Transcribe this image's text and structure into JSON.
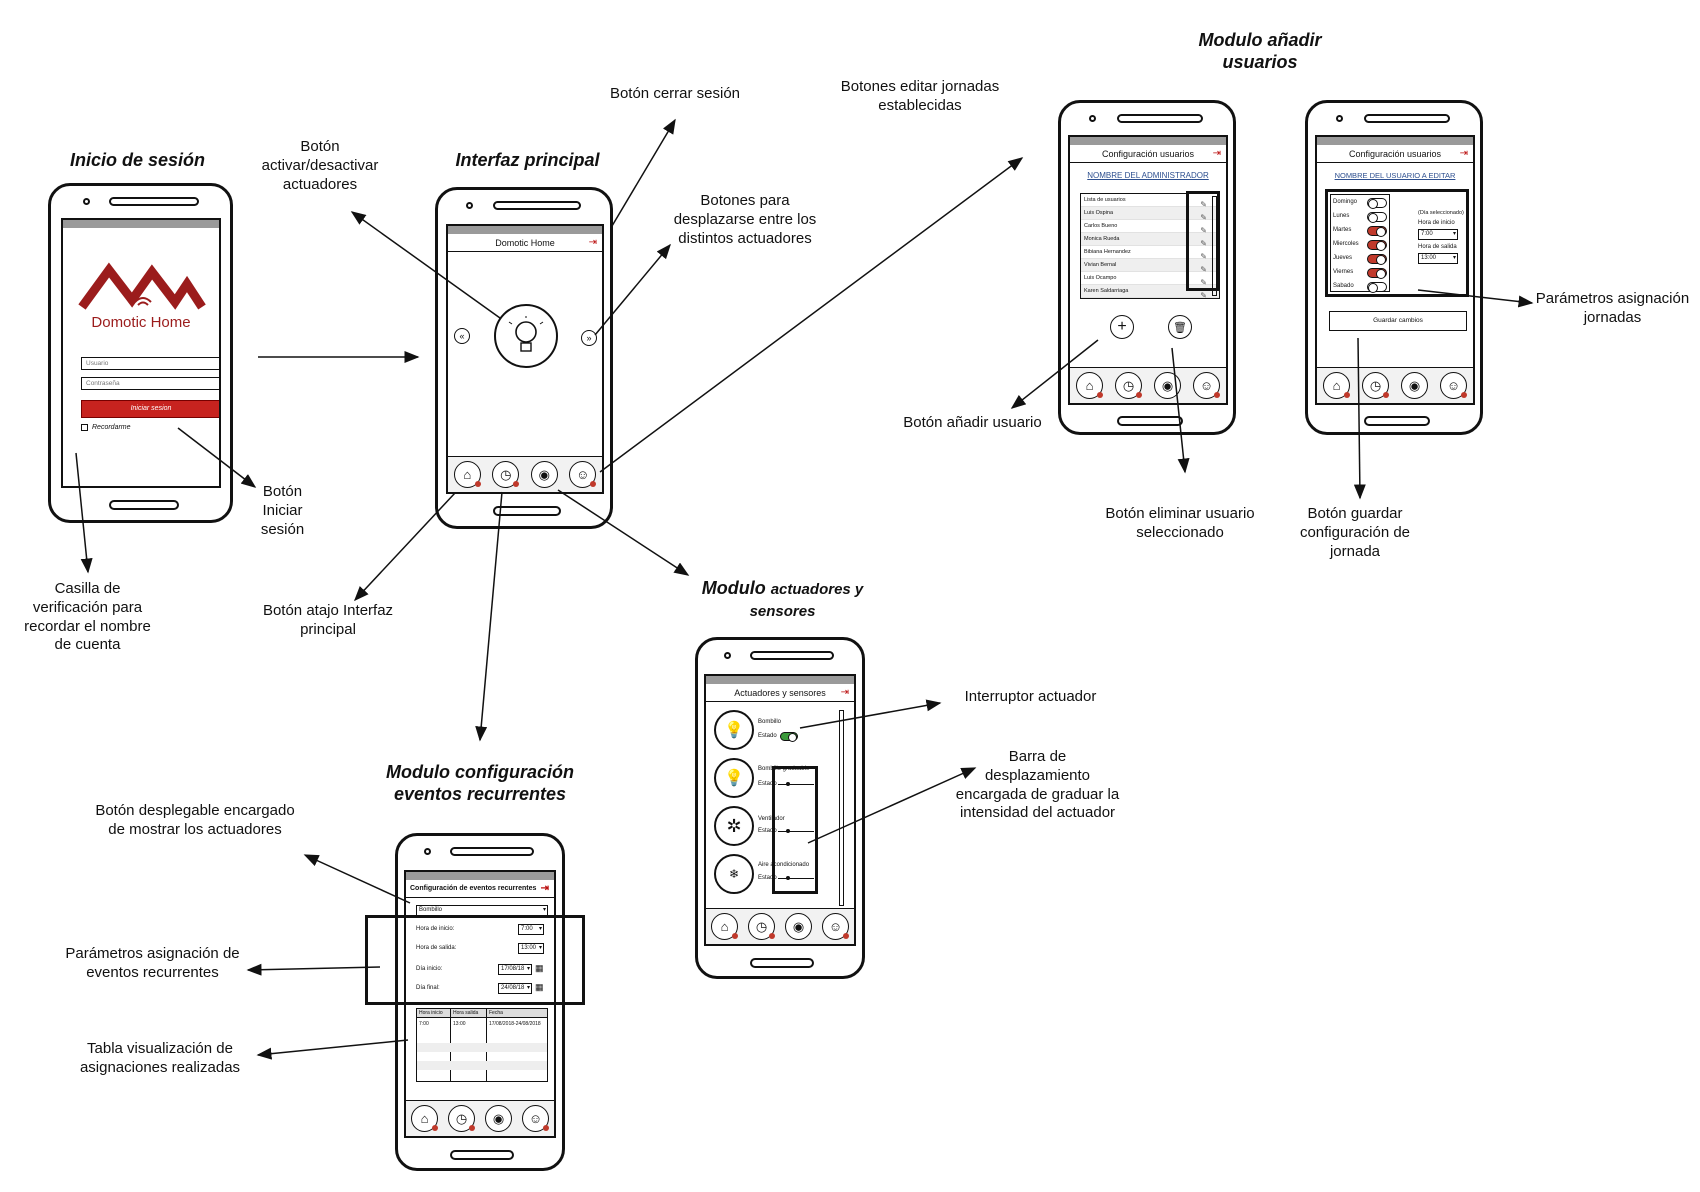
{
  "titles": {
    "login": "Inicio de sesión",
    "main": "Interfaz principal",
    "users": "Modulo añadir usuarios",
    "actuators_a": "Modulo",
    "actuators_b": "actuadores y sensores",
    "events": "Modulo configuración eventos recurrentes"
  },
  "callouts": {
    "toggle_actuators": "Botón activar/desactivar actuadores",
    "logout": "Botón cerrar sesión",
    "nav_actuators": "Botones para desplazarse entre los distintos actuadores",
    "edit_shifts": "Botones editar jornadas establecidas",
    "login_button": "Botón Iniciar sesión",
    "remember": "Casilla de verificación para recordar el nombre de cuenta",
    "home_shortcut": "Botón atajo Interfaz  principal",
    "add_user": "Botón añadir usuario",
    "delete_user": "Botón eliminar usuario seleccionado",
    "save_shift": "Botón guardar configuración de jornada",
    "shift_params": "Parámetros asignación jornadas",
    "actuator_switch": "Interruptor  actuador",
    "intensity_bar": "Barra de desplazamiento encargada de graduar la intensidad del actuador",
    "dropdown": "Botón desplegable encargado de mostrar los actuadores",
    "event_params": "Parámetros asignación de eventos recurrentes",
    "assign_table": "Tabla visualización de asignaciones realizadas"
  },
  "login_screen": {
    "brand": "Domotic Home",
    "user_placeholder": "Usuario",
    "pass_placeholder": "Contraseña",
    "login_btn": "Iniciar sesion",
    "remember_label": "Recordarme"
  },
  "main_screen": {
    "appbar": "Domotic Home",
    "prev": "«",
    "next": "»"
  },
  "users_screen": {
    "appbar": "Configuración usuarios",
    "admin_header": "NOMBRE DEL ADMINISTRADOR",
    "list": [
      "Lista de usuarios",
      "Luis Ospina",
      "Carlos Bueno",
      "Monica Rueda",
      "Bibiana Hernandez",
      "Vivian Bernal",
      "Luis Ocampo",
      "Karen Saldarriaga"
    ]
  },
  "shift_screen": {
    "appbar": "Configuración usuarios",
    "user_header": "NOMBRE DEL USUARIO A EDITAR",
    "days": [
      "Domingo",
      "Lunes",
      "Martes",
      "Miercoles",
      "Jueves",
      "Viernes",
      "Sabado"
    ],
    "days_on": [
      false,
      false,
      true,
      true,
      true,
      true,
      false
    ],
    "selected_day": "(Día seleccionado)",
    "start_label": "Hora de inicio",
    "start_value": "7:00",
    "end_label": "Hora de salida",
    "end_value": "13:00",
    "save_btn": "Guardar cambios"
  },
  "actuators_screen": {
    "appbar": "Actuadores y sensores",
    "state_label": "Estado",
    "items": [
      "Bombillo",
      "Bombillo graduable",
      "Ventilador",
      "Aire acondicionado"
    ]
  },
  "events_screen": {
    "appbar": "Configuración de eventos recurrentes",
    "device": "Bombillo",
    "start_label": "Hora de inicio:",
    "start_value": "7:00",
    "end_label": "Hora de salida:",
    "end_value": "13:00",
    "from_label": "Día inicio:",
    "from_value": "17/08/18",
    "to_label": "Día final:",
    "to_value": "24/08/18",
    "table_headers": [
      "Hora inicio",
      "Hora salida",
      "Fecha"
    ],
    "table_row": [
      "7:00",
      "13:00",
      "17/08/2018-24/08/2018"
    ]
  },
  "colors": {
    "brand_red": "#9b1c1c",
    "button_red": "#c7231f",
    "switch_green": "#3a9a3a"
  }
}
